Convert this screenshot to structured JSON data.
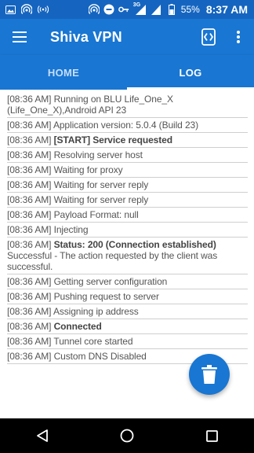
{
  "status_bar": {
    "left_icons": [
      "image-icon",
      "wifi-hotspot-icon",
      "broadcast-icon"
    ],
    "right_icons": [
      "hotspot-icon",
      "do-not-disturb-icon",
      "key-icon",
      "signal-3g-icon",
      "signal-bars-icon"
    ],
    "network_type": "3G",
    "battery_percent": "55%",
    "time": "8:37 AM"
  },
  "app_bar": {
    "title": "Shiva VPN",
    "menu_icon": "hamburger-menu-icon",
    "action_icon": "connection-toggle-icon",
    "overflow_icon": "more-vert-icon"
  },
  "tabs": [
    {
      "label": "HOME",
      "active": false
    },
    {
      "label": "LOG",
      "active": true
    }
  ],
  "log_entries": [
    {
      "time": "[08:36 AM]",
      "message": "Running on BLU Life_One_X (Life_One_X),Android API 23",
      "bold": false
    },
    {
      "time": "[08:36 AM]",
      "message": "Application version: 5.0.4 (Build 23)",
      "bold": false
    },
    {
      "time": "[08:36 AM]",
      "message": "[START] Service requested",
      "bold": true
    },
    {
      "time": "[08:36 AM]",
      "message": "Resolving server host",
      "bold": false
    },
    {
      "time": "[08:36 AM]",
      "message": "Waiting for proxy",
      "bold": false
    },
    {
      "time": "[08:36 AM]",
      "message": "Waiting for server reply",
      "bold": false
    },
    {
      "time": "[08:36 AM]",
      "message": "Waiting for server reply",
      "bold": false
    },
    {
      "time": "[08:36 AM]",
      "message": "Payload Format: null",
      "bold": false
    },
    {
      "time": "[08:36 AM]",
      "message": "Injecting",
      "bold": false
    },
    {
      "time": "[08:36 AM]",
      "message": "Status: 200 (Connection established)",
      "bold": true,
      "detail": "Successful - The action requested by the client was successful."
    },
    {
      "time": "[08:36 AM]",
      "message": "Getting server configuration",
      "bold": false
    },
    {
      "time": "[08:36 AM]",
      "message": "Pushing request to server",
      "bold": false
    },
    {
      "time": "[08:36 AM]",
      "message": "Assigning ip address",
      "bold": false
    },
    {
      "time": "[08:36 AM]",
      "message": "Connected",
      "bold": true
    },
    {
      "time": "[08:36 AM]",
      "message": "Tunnel core started",
      "bold": false
    },
    {
      "time": "[08:36 AM]",
      "message": "Custom DNS Disabled",
      "bold": false
    }
  ],
  "fab": {
    "icon": "trash-icon"
  },
  "nav_bar": {
    "icons": [
      "back-icon",
      "home-icon",
      "recents-icon"
    ]
  },
  "colors": {
    "status_bar": "#1565c0",
    "primary": "#1976d2",
    "log_text": "#555555",
    "divider": "#cfcfcf"
  }
}
